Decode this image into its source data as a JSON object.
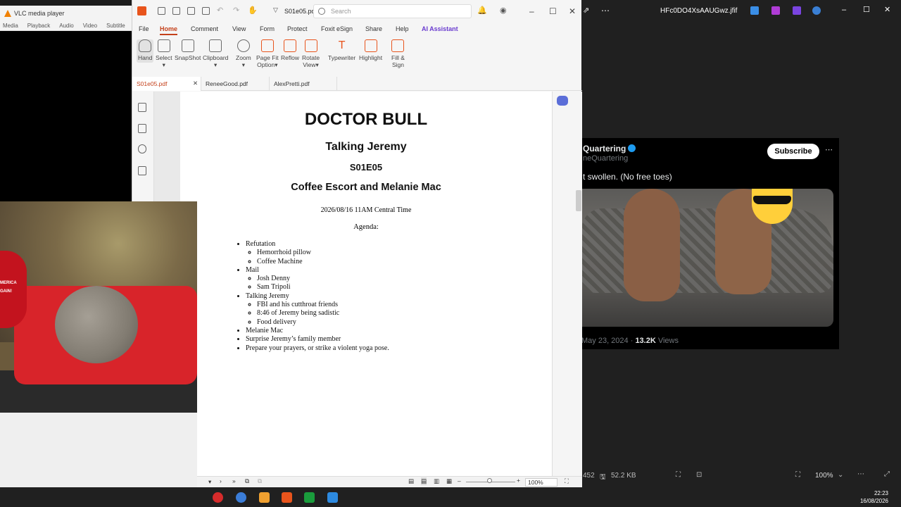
{
  "vlc": {
    "title": "VLC media player",
    "menu": [
      "Media",
      "Playback",
      "Audio",
      "Video",
      "Subtitle"
    ]
  },
  "foxit": {
    "doc_name": "S01e05.pdf",
    "search_placeholder": "Search",
    "menu": [
      "File",
      "Home",
      "Comment",
      "View",
      "Form",
      "Protect",
      "Foxit eSign",
      "Share",
      "Help",
      "AI Assistant"
    ],
    "active_menu": "Home",
    "ribbon": [
      {
        "l1": "Hand",
        "l2": ""
      },
      {
        "l1": "Select",
        "l2": ""
      },
      {
        "l1": "SnapShot",
        "l2": ""
      },
      {
        "l1": "Clipboard",
        "l2": ""
      },
      {
        "l1": "Zoom",
        "l2": ""
      },
      {
        "l1": "Page Fit",
        "l2": "Option"
      },
      {
        "l1": "Reflow",
        "l2": ""
      },
      {
        "l1": "Rotate",
        "l2": "View"
      },
      {
        "l1": "Typewriter",
        "l2": ""
      },
      {
        "l1": "Highlight",
        "l2": ""
      },
      {
        "l1": "Fill &",
        "l2": "Sign"
      }
    ],
    "tabs": [
      "S01e05.pdf",
      "ReneeGood.pdf",
      "AlexPretti.pdf"
    ],
    "zoom": "100%"
  },
  "document": {
    "title": "DOCTOR BULL",
    "subtitle": "Talking Jeremy",
    "episode": "S01E05",
    "guests": "Coffee Escort and Melanie Mac",
    "datetime": "2026/08/16 11AM Central Time",
    "agenda_label": "Agenda:",
    "agenda": [
      {
        "item": "Refutation",
        "sub": [
          "Hemorrhoid pillow",
          "Coffee Machine"
        ]
      },
      {
        "item": "Mail",
        "sub": [
          "Josh Denny",
          "Sam Tripoli"
        ]
      },
      {
        "item": "Talking Jeremy",
        "sub": [
          "FBI and his cutthroat friends",
          "8:46 of Jeremy being sadistic",
          "Food delivery"
        ]
      },
      {
        "item": "Melanie Mac",
        "sub": []
      },
      {
        "item": "Surprise Jeremy’s family member",
        "sub": []
      },
      {
        "item": "Prepare your prayers, or strike a violent yoga pose.",
        "sub": []
      }
    ]
  },
  "viewer": {
    "filename": "HFc0DO4XsAAUGwz.jfif",
    "size_label": "452",
    "file_size": "52.2 KB",
    "zoom": "100%"
  },
  "tweet": {
    "name": "Quartering",
    "handle": "neQuartering",
    "subscribe": "Subscribe",
    "text": "t swollen. (No free toes)",
    "date": "May 23, 2024 · ",
    "views_count": "13.2K",
    "views_label": " Views"
  },
  "camera_overlay": {
    "hat_text": "MERICA\nGAIN!"
  },
  "taskbar": {
    "time": "22:23",
    "date": "16/08/2026"
  }
}
